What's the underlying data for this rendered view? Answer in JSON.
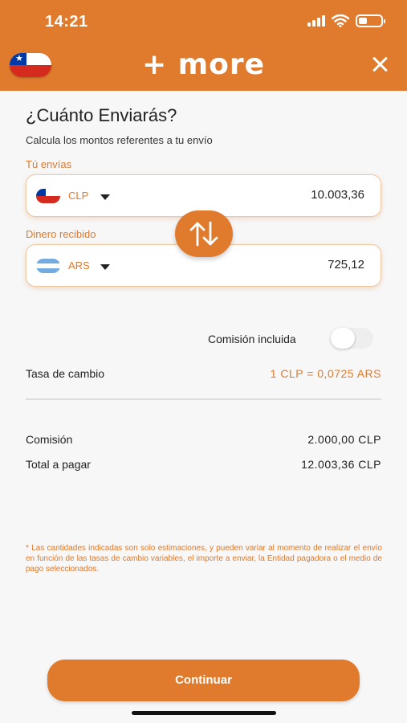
{
  "status_bar": {
    "time": "14:21"
  },
  "header": {
    "logo": "+ more",
    "close_icon": "close-icon",
    "flag": "chile-flag",
    "color": "#e07a2c"
  },
  "title": "¿Cuánto Enviarás?",
  "subtitle": "Calcula los montos referentes a tu envío",
  "send": {
    "label": "Tú envías",
    "currency": "CLP",
    "amount": "10.003,36",
    "flag": "chile-flag"
  },
  "receive": {
    "label": "Dinero recibido",
    "currency": "ARS",
    "amount": "725,12",
    "flag": "argentina-flag"
  },
  "commission_toggle": {
    "label": "Comisión incluida",
    "on": false
  },
  "rate": {
    "label": "Tasa de cambio",
    "value": "1  CLP = 0,0725  ARS"
  },
  "commission": {
    "label": "Comisión",
    "value": "2.000,00  CLP"
  },
  "total": {
    "label": "Total a pagar",
    "value": "12.003,36  CLP"
  },
  "disclaimer": "* Las cantidades indicadas son solo estimaciones, y pueden variar al momento de realizar el envío en función de las tasas de cambio variables, el importe a enviar, la Entidad pagadora o el medio de pago seleccionados.",
  "continue_label": "Continuar"
}
